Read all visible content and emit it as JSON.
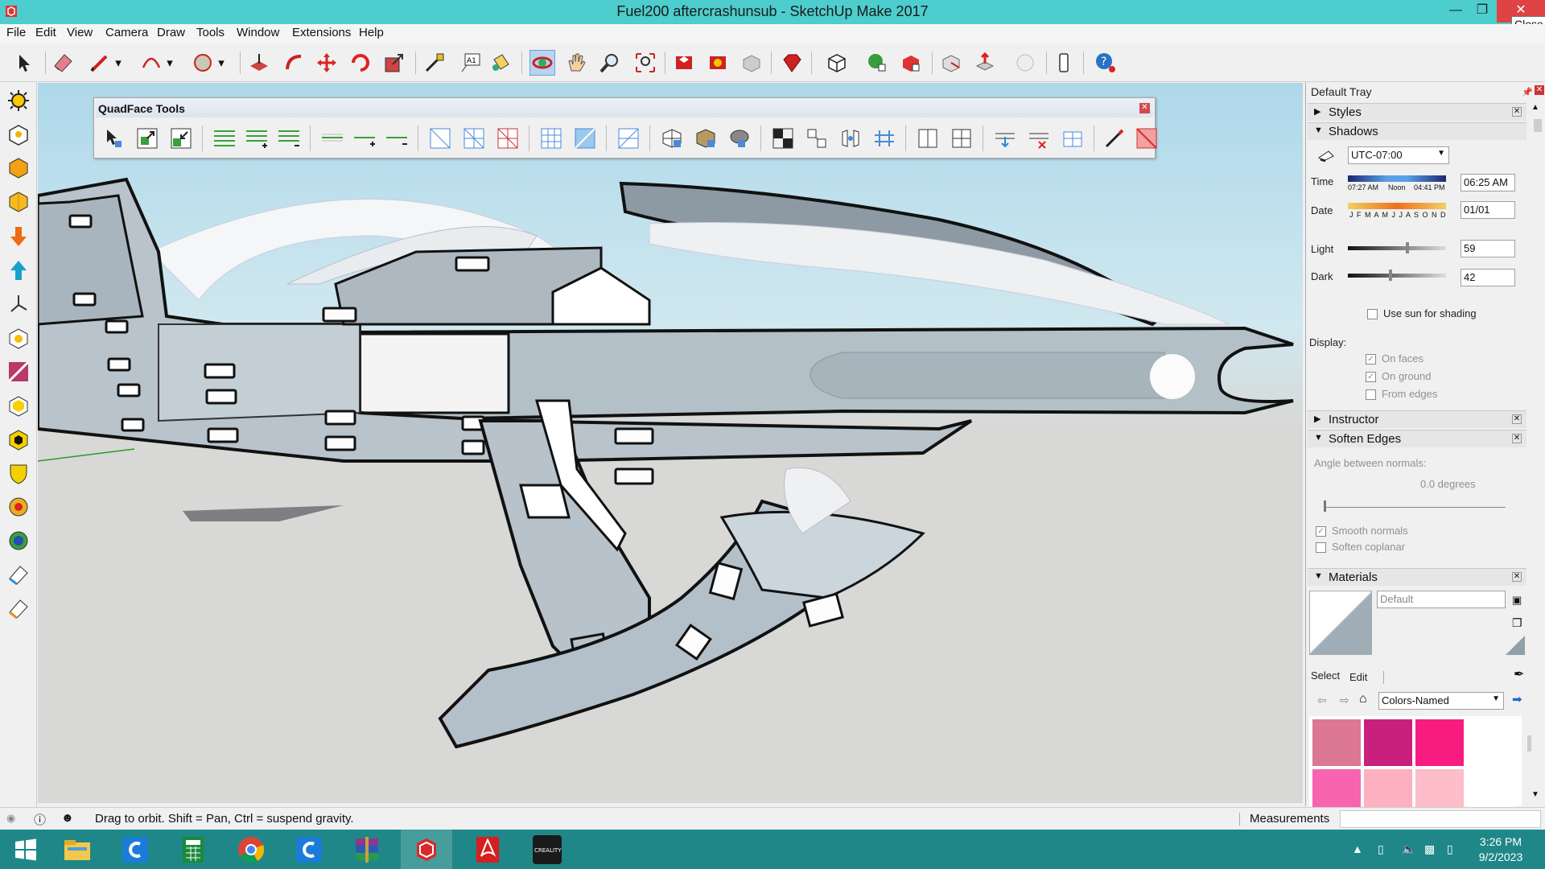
{
  "window": {
    "title": "Fuel200 aftercrashunsub - SketchUp Make 2017",
    "close_tooltip": "Close"
  },
  "menu": [
    "File",
    "Edit",
    "View",
    "Camera",
    "Draw",
    "Tools",
    "Window",
    "Extensions",
    "Help"
  ],
  "quadface": {
    "title": "QuadFace Tools"
  },
  "tray": {
    "title": "Default Tray",
    "styles": "Styles",
    "shadows": {
      "title": "Shadows",
      "utc": "UTC-07:00",
      "time_label": "Time",
      "time_marks": [
        "07:27 AM",
        "Noon",
        "04:41 PM"
      ],
      "time_value": "06:25 AM",
      "date_label": "Date",
      "months": "J F M A M J J A S O N D",
      "date_value": "01/01",
      "light_label": "Light",
      "light_value": "59",
      "dark_label": "Dark",
      "dark_value": "42",
      "light_level": 0.59,
      "dark_level": 0.42,
      "use_sun": "Use sun for shading",
      "display_label": "Display:",
      "on_faces": "On faces",
      "on_ground": "On ground",
      "from_edges": "From edges"
    },
    "instructor": "Instructor",
    "soften": {
      "title": "Soften Edges",
      "angle_label": "Angle between normals:",
      "angle_value": "0.0  degrees",
      "smooth": "Smooth normals",
      "coplanar": "Soften coplanar"
    },
    "materials": {
      "title": "Materials",
      "name": "Default",
      "tab_select": "Select",
      "tab_edit": "Edit",
      "library": "Colors-Named",
      "swatches": [
        "#dc7894",
        "#c8207c",
        "#f81c80",
        "#ffffff",
        "#f864b0",
        "#fcb0c0",
        "#fcbcc8",
        "#ffffff"
      ]
    }
  },
  "status": {
    "text": "Drag to orbit. Shift = Pan, Ctrl = suspend gravity.",
    "measurements": "Measurements"
  },
  "taskbar": {
    "time": "3:26 PM",
    "date": "9/2/2023"
  }
}
